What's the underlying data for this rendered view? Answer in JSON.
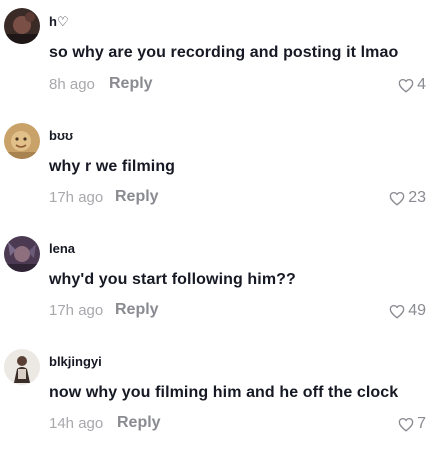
{
  "comments": [
    {
      "username": "h♡",
      "text": "so why are you recording and posting it lmao",
      "time": "8h ago",
      "reply_label": "Reply",
      "likes": "4",
      "avatar_icon": "user-avatar-dark-icon"
    },
    {
      "username": "bʊʊ",
      "text": "why r we filming",
      "time": "17h ago",
      "reply_label": "Reply",
      "likes": "23",
      "avatar_icon": "user-avatar-tan-icon"
    },
    {
      "username": "lena",
      "text": "why'd you start following him??",
      "time": "17h ago",
      "reply_label": "Reply",
      "likes": "49",
      "avatar_icon": "user-avatar-purple-icon"
    },
    {
      "username": "blkjingyi",
      "text": "now why you filming him and he off the clock",
      "time": "14h ago",
      "reply_label": "Reply",
      "likes": "7",
      "avatar_icon": "user-avatar-light-icon"
    }
  ],
  "colors": {
    "text": "#161823",
    "muted": "#a8a8ad",
    "action": "#8a8b91",
    "background": "#ffffff"
  },
  "icons": {
    "like": "heart-outline-icon"
  }
}
